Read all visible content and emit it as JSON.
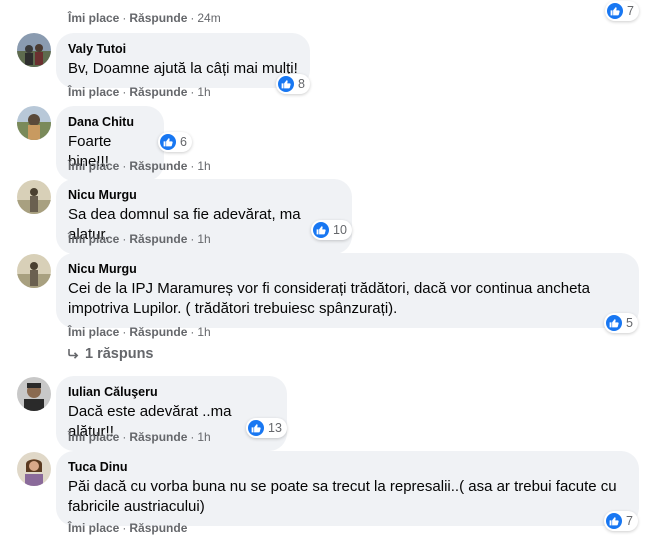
{
  "actions": {
    "like": "Îmi place",
    "reply": "Răspunde",
    "separator": "·"
  },
  "colors": {
    "bubble": "#f0f2f5",
    "secondary_text": "#65676b",
    "like_blue": "#1877f2"
  },
  "comments": [
    {
      "author": "",
      "text": "",
      "time": "24m",
      "reactions": "7",
      "reaction_icon": "like-icon"
    },
    {
      "author": "Valy Tutoi",
      "text": "Bv, Doamne ajută la câți mai mulți!",
      "time": "1h",
      "reactions": "8",
      "reaction_icon": "like-icon"
    },
    {
      "author": "Dana Chitu",
      "text": "Foarte bine!!!",
      "time": "1h",
      "reactions": "6",
      "reaction_icon": "like-icon"
    },
    {
      "author": "Nicu Murgu",
      "text": "Sa dea domnul sa fie adevărat, ma alatur.",
      "time": "1h",
      "reactions": "10",
      "reaction_icon": "like-icon"
    },
    {
      "author": "Nicu Murgu",
      "text": "Cei de la IPJ Maramureș vor fi considerați trădători, dacă vor continua ancheta impotriva Lupilor. ( trădători trebuiesc spânzurați).",
      "time": "1h",
      "reactions": "5",
      "reaction_icon": "like-icon",
      "replies_label": "1 răspuns"
    },
    {
      "author": "Iulian Căluşeru",
      "text": "Dacă este adevărat ..ma alătur!!",
      "time": "1h",
      "reactions": "13",
      "reaction_icon": "like-icon"
    },
    {
      "author": "Tuca Dinu",
      "text": "Păi dacă cu vorba buna nu se poate sa trecut la represalii..( asa ar trebui facute cu fabricile austriacului)",
      "time": "",
      "reactions": "7",
      "reaction_icon": "like-icon"
    }
  ]
}
